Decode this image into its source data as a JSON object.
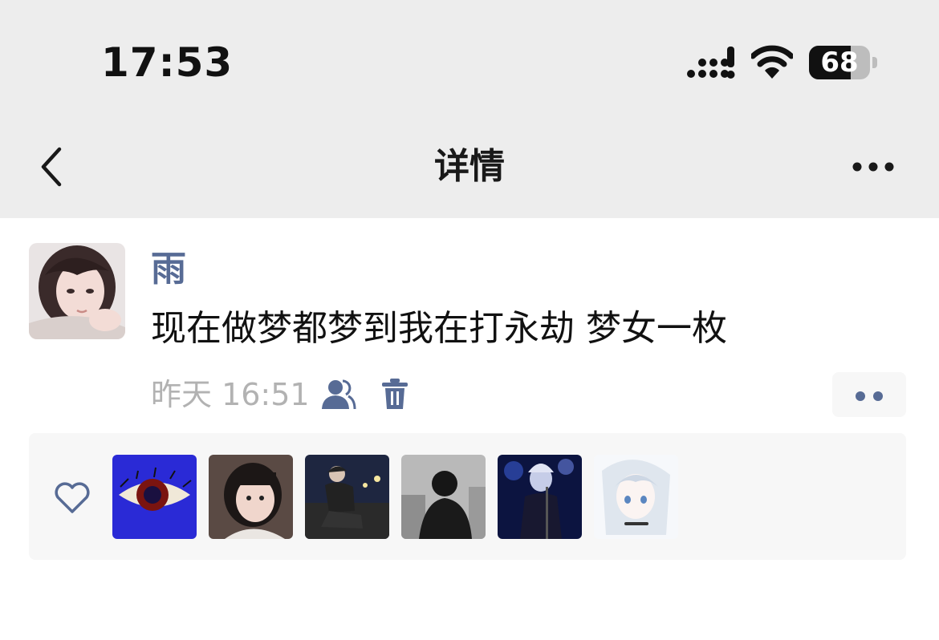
{
  "status_bar": {
    "time": "17:53",
    "battery_level": "68",
    "battery_fraction": 0.68
  },
  "nav": {
    "title": "详情",
    "back_icon": "chevron-left-icon",
    "more_icon": "ellipsis-icon"
  },
  "post": {
    "author": "雨",
    "content": "现在做梦都梦到我在打永劫 梦女一枚",
    "timestamp": "昨天 16:51",
    "privacy_icon": "people-icon",
    "delete_icon": "trash-icon",
    "comment_icon": "two-dots-icon"
  },
  "likes": {
    "icon": "heart-icon",
    "users": [
      "liker-1",
      "liker-2",
      "liker-3",
      "liker-4",
      "liker-5",
      "liker-6"
    ]
  },
  "colors": {
    "nav_background": "#ededed",
    "link_blue": "#576b95",
    "muted_text": "#b2b2b2",
    "panel_background": "#f7f7f7"
  }
}
